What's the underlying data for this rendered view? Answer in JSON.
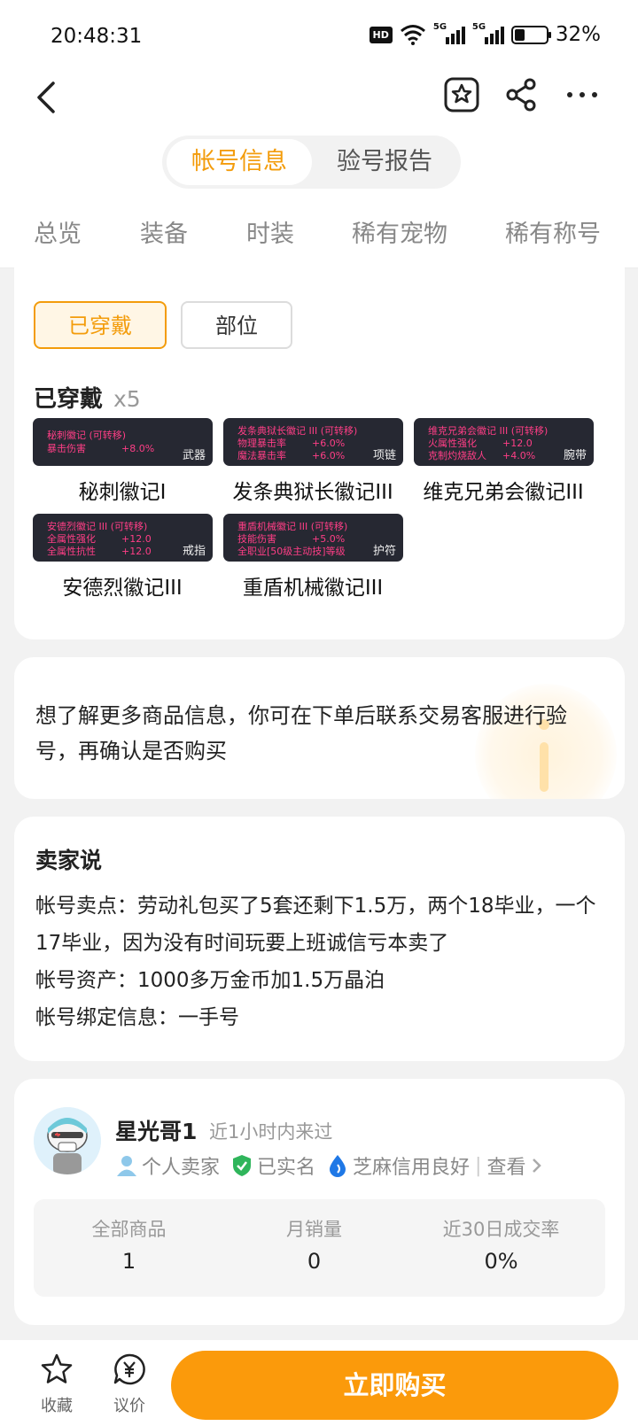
{
  "status_bar": {
    "time": "20:48:31",
    "hd": "HD",
    "net1": "5G",
    "net2": "5G",
    "battery": "32%"
  },
  "toggle": {
    "account_info": "帐号信息",
    "inspection_report": "验号报告"
  },
  "categories": [
    "总览",
    "装备",
    "时装",
    "稀有宠物",
    "稀有称号"
  ],
  "equipment": {
    "filter_worn": "已穿戴",
    "filter_slot": "部位",
    "section_title": "已穿戴",
    "count": "x5",
    "items": [
      {
        "name": "秘刺徽记I",
        "slot": "武器",
        "lines": [
          {
            "label": "秘刺徽记 (可转移)",
            "value": ""
          },
          {
            "label": "暴击伤害",
            "value": "+8.0%"
          }
        ]
      },
      {
        "name": "发条典狱长徽记III",
        "slot": "项链",
        "lines": [
          {
            "label": "发条典狱长徽记 III (可转移)",
            "value": ""
          },
          {
            "label": "物理暴击率",
            "value": "+6.0%"
          },
          {
            "label": "魔法暴击率",
            "value": "+6.0%"
          }
        ]
      },
      {
        "name": "维克兄弟会徽记III",
        "slot": "腕带",
        "lines": [
          {
            "label": "维克兄弟会徽记 III (可转移)",
            "value": ""
          },
          {
            "label": "火属性强化",
            "value": "+12.0"
          },
          {
            "label": "克制灼烧敌人",
            "value": "+4.0%"
          }
        ]
      },
      {
        "name": "安德烈徽记III",
        "slot": "戒指",
        "lines": [
          {
            "label": "安德烈徽记 III (可转移)",
            "value": ""
          },
          {
            "label": "全属性强化",
            "value": "+12.0"
          },
          {
            "label": "全属性抗性",
            "value": "+12.0"
          }
        ]
      },
      {
        "name": "重盾机械徽记III",
        "slot": "护符",
        "lines": [
          {
            "label": "重盾机械徽记 III (可转移)",
            "value": ""
          },
          {
            "label": "技能伤害",
            "value": "+5.0%"
          },
          {
            "label": "全职业[50级主动技]等级",
            "value": ""
          }
        ]
      }
    ]
  },
  "notice": {
    "text": "想了解更多商品信息，你可在下单后联系交易客服进行验号，再确认是否购买"
  },
  "seller_says": {
    "title": "卖家说",
    "selling_point": "帐号卖点：劳动礼包买了5套还剩下1.5万，两个18毕业，一个17毕业，因为没有时间玩要上班诚信亏本卖了",
    "assets": "帐号资产：1000多万金币加1.5万晶泊",
    "binding": "帐号绑定信息：一手号"
  },
  "seller": {
    "name": "星光哥1",
    "active": "近1小时内来过",
    "type": "个人卖家",
    "verified": "已实名",
    "credit": "芝麻信用良好",
    "view": "查看",
    "stats": [
      {
        "label": "全部商品",
        "value": "1"
      },
      {
        "label": "月销量",
        "value": "0"
      },
      {
        "label": "近30日成交率",
        "value": "0%"
      }
    ]
  },
  "bottom_bar": {
    "favorite": "收藏",
    "negotiate": "议价",
    "buy_now": "立即购买"
  },
  "colors": {
    "accent": "#f39c0b",
    "buy_button": "#fb9a0b",
    "badge_text": "#ff3e86",
    "badge_bg": "#262832"
  },
  "icons": [
    "back-icon",
    "favorite-star-icon",
    "share-icon",
    "more-icon",
    "person-icon",
    "verified-shield-icon",
    "credit-drop-icon",
    "chevron-right-icon",
    "star-icon",
    "yen-bubble-icon"
  ]
}
